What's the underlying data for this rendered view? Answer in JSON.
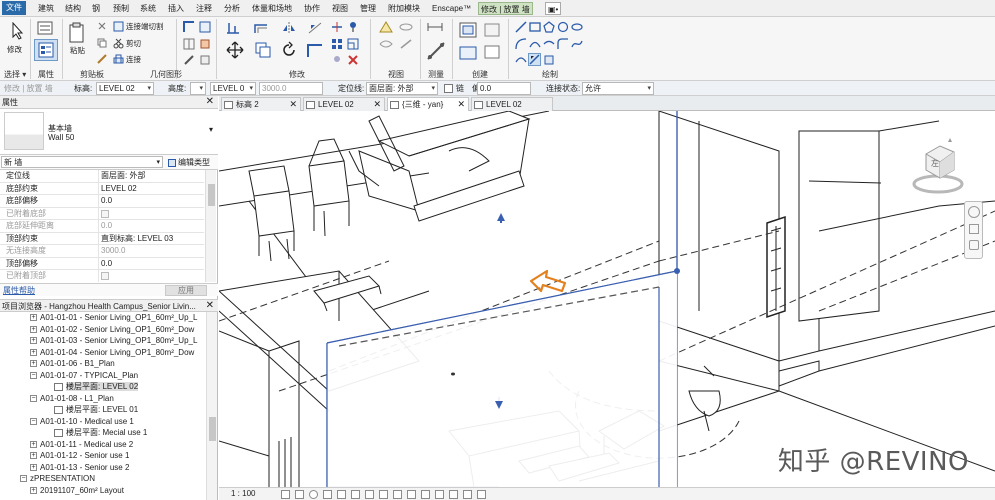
{
  "menubar": {
    "file": "文件",
    "items": [
      "建筑",
      "结构",
      "钢",
      "预制",
      "系统",
      "插入",
      "注释",
      "分析",
      "体量和场地",
      "协作",
      "视图",
      "管理",
      "附加模块",
      "Enscape™"
    ],
    "active": "修改 | 放置 墙",
    "extra": "▣•"
  },
  "ribbon": {
    "panels": [
      "选择",
      "属性",
      "剪贴板",
      "几何图形",
      "修改",
      "视图",
      "测量",
      "创建",
      "绘制"
    ],
    "buttons": {
      "modify": "修改",
      "paste": "粘贴",
      "join_cut": "连接端切割",
      "cut": "剪切",
      "join": "连接"
    }
  },
  "options_bar": {
    "context": "修改 | 放置 墙",
    "level_label": "标高:",
    "level_value": "LEVEL 02",
    "height_label": "高度:",
    "height_value": "LEVEL 0",
    "height_num": "3000.0",
    "locline_label": "定位线:",
    "locline_value": "面层面: 外部",
    "chain_label": "链",
    "offset_label": "偏移:",
    "offset_value": "0.0",
    "join_label": "连接状态:",
    "join_value": "允许"
  },
  "properties": {
    "title": "属性",
    "type_family": "基本墙",
    "type_name": "Wall 50",
    "instance": "新 墙",
    "edit_type": "编辑类型",
    "rows": [
      {
        "name": "定位线",
        "value": "面层面: 外部"
      },
      {
        "name": "底部约束",
        "value": "LEVEL 02"
      },
      {
        "name": "底部偏移",
        "value": "0.0"
      },
      {
        "name": "已附着底部",
        "value": ""
      },
      {
        "name": "底部延伸距离",
        "value": "0.0"
      },
      {
        "name": "顶部约束",
        "value": "直到标高: LEVEL 03"
      },
      {
        "name": "无连接高度",
        "value": "3000.0"
      },
      {
        "name": "顶部偏移",
        "value": "0.0"
      },
      {
        "name": "已附着顶部",
        "value": ""
      }
    ],
    "help": "属性帮助",
    "apply": "应用"
  },
  "project_browser": {
    "title": "项目浏览器 - Hangzhou Health Campus_Senior Livin...",
    "nodes": [
      {
        "label": "A01-01-01 - Senior Living_OP1_60m²_Up_L"
      },
      {
        "label": "A01-01-02 - Senior Living_OP1_60m²_Dow"
      },
      {
        "label": "A01-01-03 - Senior Living_OP1_80m²_Up_L"
      },
      {
        "label": "A01-01-04 - Senior Living_OP1_80m²_Dow"
      },
      {
        "label": "A01-01-06 - B1_Plan"
      },
      {
        "label": "A01-01-07 - TYPICAL_Plan"
      },
      {
        "label": "楼层平面: LEVEL 02"
      },
      {
        "label": "A01-01-08 - L1_Plan"
      },
      {
        "label": "楼层平面: LEVEL 01"
      },
      {
        "label": "A01-01-10 - Medical use 1"
      },
      {
        "label": "楼层平面: Mecial use 1"
      },
      {
        "label": "A01-01-11 - Medical use 2"
      },
      {
        "label": "A01-01-12 - Senior use 1"
      },
      {
        "label": "A01-01-13 - Senior use 2"
      },
      {
        "label": "zPRESENTATION"
      },
      {
        "label": "20191107_60m² Layout"
      }
    ]
  },
  "view_tabs": [
    "标高 2",
    "LEVEL 02",
    "{三维 - yan}",
    "LEVEL 02"
  ],
  "status": {
    "scale": "1 : 100"
  },
  "watermark": "知乎 @REVINO",
  "viewcube": {
    "face": "左"
  }
}
